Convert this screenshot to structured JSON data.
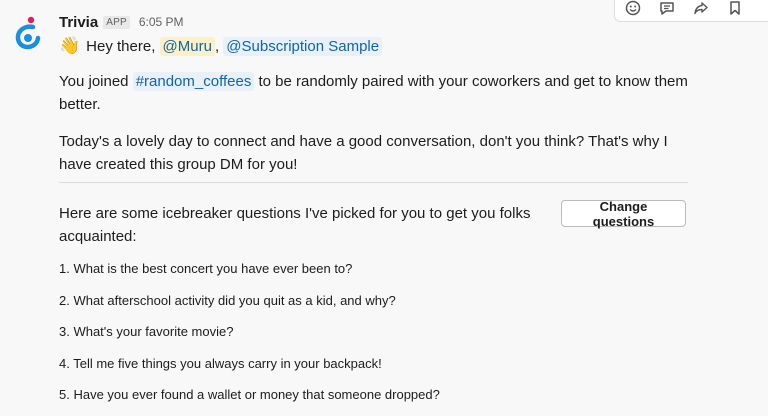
{
  "message": {
    "sender": "Trivia",
    "badge": "APP",
    "time": "6:05 PM",
    "greeting": {
      "emoji": "👋",
      "prefix": "Hey there,",
      "mention_1": "@Muru",
      "separator": ",",
      "mention_2": "@Subscription Sample"
    },
    "paragraph_1": {
      "before": "You joined ",
      "channel": "#random_coffees",
      "after": " to be randomly paired with your coworkers and get to know them better."
    },
    "paragraph_2": "Today's a lovely day to connect and have a good conversation, don't you think? That's why I have created this group DM for you!",
    "icebreaker_intro": "Here are some icebreaker questions I've picked for you to get you folks acquainted:",
    "change_button": "Change questions",
    "questions": [
      "1. What is the best concert you have ever been to?",
      "2. What afterschool activity did you quit as a kid, and why?",
      "3. What's your favorite movie?",
      "4. Tell me five things you always carry in your backpack!",
      "5. Have you ever found a wallet or money that someone dropped?"
    ]
  },
  "toolbar": {
    "icons": [
      "add-reaction-icon",
      "reply-in-thread-icon",
      "share-icon",
      "bookmark-icon"
    ]
  },
  "colors": {
    "link": "#1264a3",
    "mention_bg": "#fdf0c8",
    "channel_bg": "#e8f1f9",
    "avatar_blue": "#1a8ee0",
    "avatar_pink": "#e01e5a"
  }
}
